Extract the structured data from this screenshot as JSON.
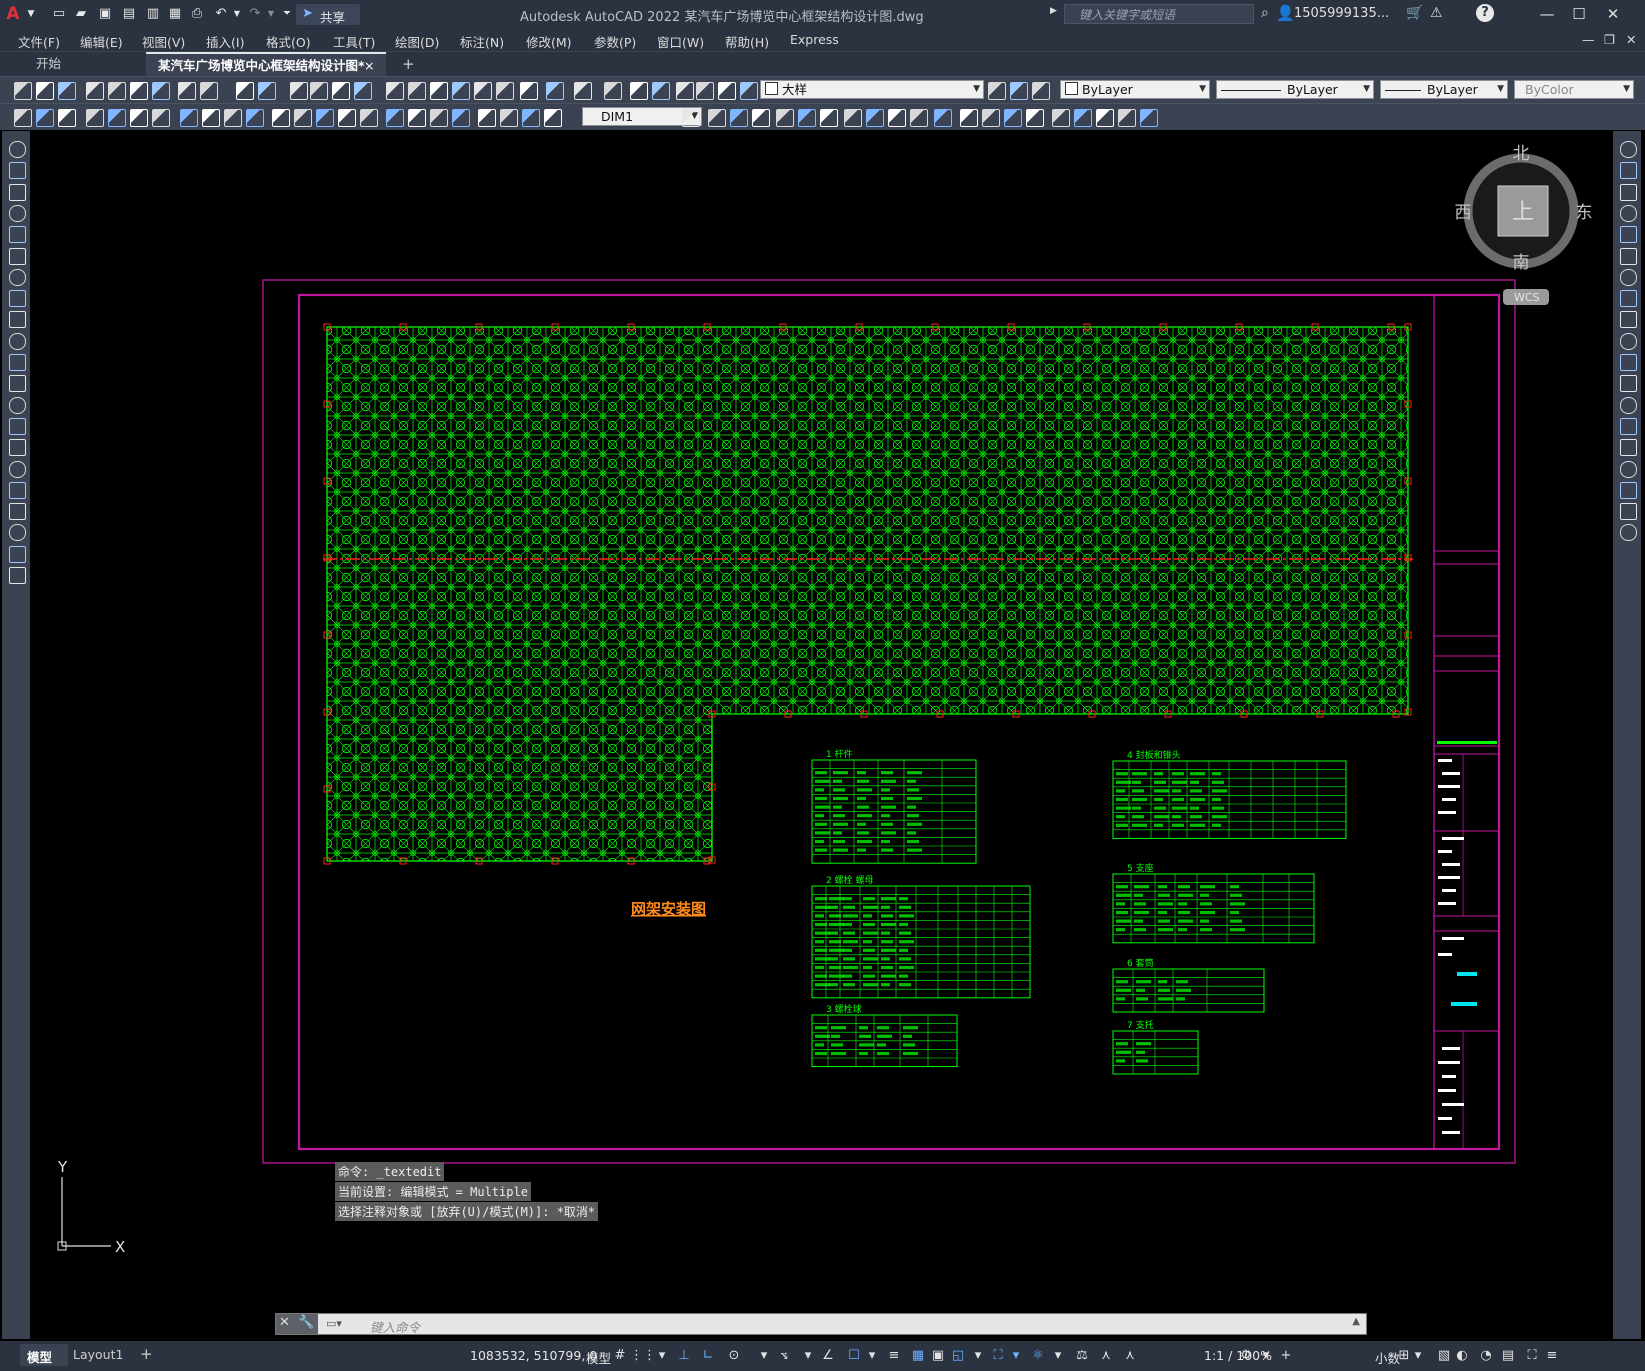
{
  "title_bar": {
    "app_title": "Autodesk AutoCAD 2022    某汽车广场博览中心框架结构设计图.dwg",
    "share_label": "共享",
    "search_placeholder": "键入关键字或短语",
    "user_name": "1505999135..."
  },
  "menu": {
    "items": [
      "文件(F)",
      "编辑(E)",
      "视图(V)",
      "插入(I)",
      "格式(O)",
      "工具(T)",
      "绘图(D)",
      "标注(N)",
      "修改(M)",
      "参数(P)",
      "窗口(W)",
      "帮助(H)",
      "Express"
    ]
  },
  "tabs": {
    "start": "开始",
    "active": "某汽车广场博览中心框架结构设计图*",
    "close": "×",
    "add": "+"
  },
  "toolbar1": {
    "layer": "大样",
    "color": "ByLayer",
    "linetype": "ByLayer",
    "lineweight": "ByLayer",
    "plotstyle": "ByColor"
  },
  "toolbar2": {
    "dimstyle": "DIM1"
  },
  "viewcube": {
    "north": "北",
    "south": "南",
    "east": "东",
    "west": "西",
    "top": "上",
    "wcs": "WCS"
  },
  "drawing": {
    "main_title": "网架安装图",
    "table_titles": [
      "1  杆件",
      "2  螺栓 螺母",
      "3  螺栓球",
      "4  封板和锥头",
      "5  支座",
      "6  套筒",
      "7  支托"
    ],
    "colors": {
      "frame": "#c0179c",
      "grid": "#00ff00",
      "axis": "#ff2020",
      "title": "#ff8c1a",
      "accent": "#00e5ee"
    }
  },
  "ucs": {
    "x_label": "X",
    "y_label": "Y"
  },
  "command": {
    "history": [
      "命令: _textedit",
      "当前设置: 编辑模式 = Multiple",
      "选择注释对象或 [放弃(U)/模式(M)]: *取消*"
    ],
    "input_placeholder": "键入命令"
  },
  "status_bar": {
    "model_tab": "模型",
    "layout_tab": "Layout1",
    "coordinates": "1083532, 510799, 0",
    "model_label": "模型",
    "scale": "1:1 / 100%",
    "units": "小数"
  }
}
